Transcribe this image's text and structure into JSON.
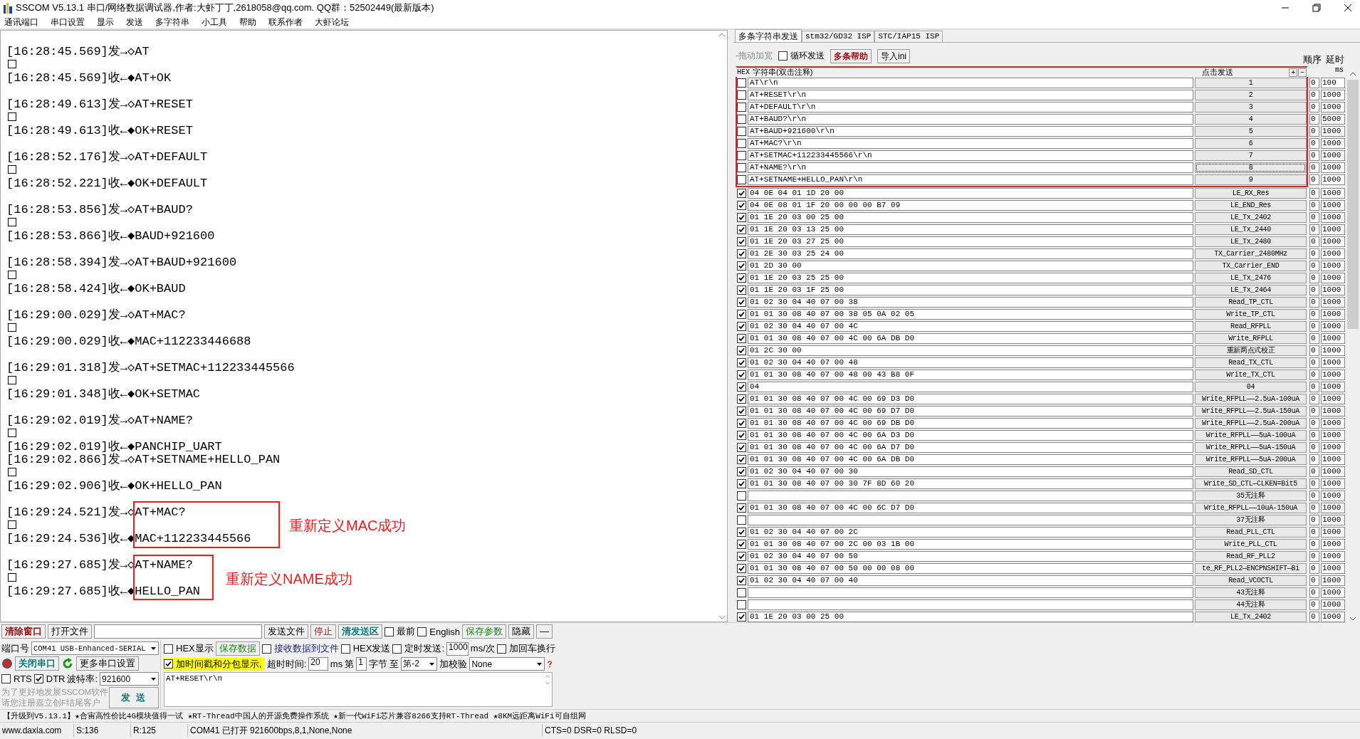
{
  "window": {
    "title": "SSCOM V5.13.1 串口/网络数据调试器,作者:大虾丁丁,2618058@qq.com. QQ群：52502449(最新版本)"
  },
  "menu": [
    "通讯端口",
    "串口设置",
    "显示",
    "发送",
    "多字符串",
    "小工具",
    "帮助",
    "联系作者",
    "大虾论坛"
  ],
  "log": {
    "lines": [
      {
        "kind": "text",
        "text": "[16:28:45.569]发→◇AT"
      },
      {
        "kind": "box"
      },
      {
        "kind": "text",
        "text": "[16:28:45.569]收←◆AT+OK"
      },
      {
        "kind": "blank"
      },
      {
        "kind": "text",
        "text": "[16:28:49.613]发→◇AT+RESET"
      },
      {
        "kind": "box"
      },
      {
        "kind": "text",
        "text": "[16:28:49.613]收←◆OK+RESET"
      },
      {
        "kind": "blank"
      },
      {
        "kind": "text",
        "text": "[16:28:52.176]发→◇AT+DEFAULT"
      },
      {
        "kind": "box"
      },
      {
        "kind": "text",
        "text": "[16:28:52.221]收←◆OK+DEFAULT"
      },
      {
        "kind": "blank"
      },
      {
        "kind": "text",
        "text": "[16:28:53.856]发→◇AT+BAUD?"
      },
      {
        "kind": "box"
      },
      {
        "kind": "text",
        "text": "[16:28:53.866]收←◆BAUD+921600"
      },
      {
        "kind": "blank"
      },
      {
        "kind": "text",
        "text": "[16:28:58.394]发→◇AT+BAUD+921600"
      },
      {
        "kind": "box"
      },
      {
        "kind": "text",
        "text": "[16:28:58.424]收←◆OK+BAUD"
      },
      {
        "kind": "blank"
      },
      {
        "kind": "text",
        "text": "[16:29:00.029]发→◇AT+MAC?"
      },
      {
        "kind": "box"
      },
      {
        "kind": "text",
        "text": "[16:29:00.029]收←◆MAC+112233446688"
      },
      {
        "kind": "blank"
      },
      {
        "kind": "text",
        "text": "[16:29:01.318]发→◇AT+SETMAC+112233445566"
      },
      {
        "kind": "box"
      },
      {
        "kind": "text",
        "text": "[16:29:01.348]收←◆OK+SETMAC"
      },
      {
        "kind": "blank"
      },
      {
        "kind": "text",
        "text": "[16:29:02.019]发→◇AT+NAME?"
      },
      {
        "kind": "box"
      },
      {
        "kind": "text",
        "text": "[16:29:02.019]收←◆PANCHIP_UART"
      },
      {
        "kind": "text",
        "text": "[16:29:02.866]发→◇AT+SETNAME+HELLO_PAN"
      },
      {
        "kind": "box"
      },
      {
        "kind": "text",
        "text": "[16:29:02.906]收←◆OK+HELLO_PAN"
      },
      {
        "kind": "blank"
      },
      {
        "kind": "text",
        "text": "[16:29:24.521]发→◇AT+MAC?"
      },
      {
        "kind": "box"
      },
      {
        "kind": "text",
        "text": "[16:29:24.536]收←◆MAC+112233445566"
      },
      {
        "kind": "blank"
      },
      {
        "kind": "text",
        "text": "[16:29:27.685]发→◇AT+NAME?"
      },
      {
        "kind": "box"
      },
      {
        "kind": "text",
        "text": "[16:29:27.685]收←◆HELLO_PAN"
      }
    ]
  },
  "annotations": [
    {
      "text": "重新定义MAC成功"
    },
    {
      "text": "重新定义NAME成功"
    }
  ],
  "tabs": [
    {
      "label": "多条字符串发送",
      "selected": true
    },
    {
      "label": "stm32/GD32 ISP",
      "selected": false
    },
    {
      "label": "STC/IAP15 ISP",
      "selected": false
    }
  ],
  "multi_send": {
    "drag_label": "-拖动加宽",
    "loop_send": {
      "label": "循环发送",
      "checked": false
    },
    "help_button": "多条帮助",
    "import_button": "导入ini",
    "order_label": "顺序",
    "delay_label": "延时",
    "hex_header": "HEX",
    "string_header": "字符串(双击注释)",
    "send_header": "点击发送",
    "add_button": "+",
    "remove_button": "−",
    "ms_label": "ms",
    "rows": [
      {
        "hex": false,
        "value": "AT\\r\\n",
        "button": "1",
        "order": "0",
        "delay": "100",
        "focused": false,
        "highlighted": true
      },
      {
        "hex": false,
        "value": "AT+RESET\\r\\n",
        "button": "2",
        "order": "0",
        "delay": "1000",
        "focused": false,
        "highlighted": true
      },
      {
        "hex": false,
        "value": "AT+DEFAULT\\r\\n",
        "button": "3",
        "order": "0",
        "delay": "1000",
        "focused": false,
        "highlighted": true
      },
      {
        "hex": false,
        "value": "AT+BAUD?\\r\\n",
        "button": "4",
        "order": "0",
        "delay": "5000",
        "focused": false,
        "highlighted": true
      },
      {
        "hex": false,
        "value": "AT+BAUD+921600\\r\\n",
        "button": "5",
        "order": "0",
        "delay": "1000",
        "focused": false,
        "highlighted": true
      },
      {
        "hex": false,
        "value": "AT+MAC?\\r\\n",
        "button": "6",
        "order": "0",
        "delay": "1000",
        "focused": false,
        "highlighted": true
      },
      {
        "hex": false,
        "value": "AT+SETMAC+112233445566\\r\\n",
        "button": "7",
        "order": "0",
        "delay": "1000",
        "focused": false,
        "highlighted": true
      },
      {
        "hex": false,
        "value": "AT+NAME?\\r\\n",
        "button": "8",
        "order": "0",
        "delay": "1000",
        "focused": true,
        "highlighted": true
      },
      {
        "hex": false,
        "value": "AT+SETNAME+HELLO_PAN\\r\\n",
        "button": "9",
        "order": "0",
        "delay": "1000",
        "focused": false,
        "highlighted": true
      },
      {
        "hex": true,
        "value": "04 0E 04 01 1D 20 00",
        "button": "LE_RX_Res",
        "order": "0",
        "delay": "1000",
        "focused": false,
        "highlighted": false
      },
      {
        "hex": true,
        "value": "04 0E 08 01 1F 20 00 00 00 B7 09",
        "button": "LE_END_Res",
        "order": "0",
        "delay": "1000",
        "focused": false,
        "highlighted": false
      },
      {
        "hex": true,
        "value": "01 1E 20 03 00 25 00",
        "button": "LE_Tx_2402",
        "order": "0",
        "delay": "1000",
        "focused": false,
        "highlighted": false
      },
      {
        "hex": true,
        "value": "01 1E 20 03 13 25 00",
        "button": "LE_Tx_2440",
        "order": "0",
        "delay": "1000",
        "focused": false,
        "highlighted": false
      },
      {
        "hex": true,
        "value": "01 1E 20 03 27 25 00",
        "button": "LE_Tx_2480",
        "order": "0",
        "delay": "1000",
        "focused": false,
        "highlighted": false
      },
      {
        "hex": true,
        "value": "01 2E 30 03 25 24 00",
        "button": "TX_Carrier_2480MHz",
        "order": "0",
        "delay": "1000",
        "focused": false,
        "highlighted": false
      },
      {
        "hex": true,
        "value": "01 2D 30 00",
        "button": "TX_Carrier_END",
        "order": "0",
        "delay": "1000",
        "focused": false,
        "highlighted": false
      },
      {
        "hex": true,
        "value": "01 1E 20 03 25 25 00",
        "button": "LE_Tx_2476",
        "order": "0",
        "delay": "1000",
        "focused": false,
        "highlighted": false
      },
      {
        "hex": true,
        "value": "01 1E 20 03 1F 25 00",
        "button": "LE_Tx_2464",
        "order": "0",
        "delay": "1000",
        "focused": false,
        "highlighted": false
      },
      {
        "hex": true,
        "value": "01 02 30 04 40 07 00 38",
        "button": "Read_TP_CTL",
        "order": "0",
        "delay": "1000",
        "focused": false,
        "highlighted": false
      },
      {
        "hex": true,
        "value": "01 01 30 08 40 07 00 38 05 0A 02 05",
        "button": "Write_TP_CTL",
        "order": "0",
        "delay": "1000",
        "focused": false,
        "highlighted": false
      },
      {
        "hex": true,
        "value": "01 02 30 04 40 07 00 4C",
        "button": "Read_RFPLL",
        "order": "0",
        "delay": "1000",
        "focused": false,
        "highlighted": false
      },
      {
        "hex": true,
        "value": "01 01 30 08 40 07 00 4C 00 6A DB D0",
        "button": "Write_RFPLL",
        "order": "0",
        "delay": "1000",
        "focused": false,
        "highlighted": false
      },
      {
        "hex": true,
        "value": "01 2C 30 00",
        "button": "重新两点式校正",
        "order": "0",
        "delay": "1000",
        "focused": false,
        "highlighted": false
      },
      {
        "hex": true,
        "value": "01 02 30 04 40 07 00 48",
        "button": "Read_TX_CTL",
        "order": "0",
        "delay": "1000",
        "focused": false,
        "highlighted": false
      },
      {
        "hex": true,
        "value": "01 01 30 08 40 07 00 48 00 43 B8 0F",
        "button": "Write_TX_CTL",
        "order": "0",
        "delay": "1000",
        "focused": false,
        "highlighted": false
      },
      {
        "hex": true,
        "value": "04",
        "button": "04",
        "order": "0",
        "delay": "1000",
        "focused": false,
        "highlighted": false
      },
      {
        "hex": true,
        "value": "01 01 30 08 40 07 00 4C 00 69 D3 D0",
        "button": "Write_RFPLL——2.5uA-100uA",
        "order": "0",
        "delay": "1000",
        "focused": false,
        "highlighted": false
      },
      {
        "hex": true,
        "value": "01 01 30 08 40 07 00 4C 00 69 D7 D0",
        "button": "Write_RFPLL——2.5uA-150uA",
        "order": "0",
        "delay": "1000",
        "focused": false,
        "highlighted": false
      },
      {
        "hex": true,
        "value": "01 01 30 08 40 07 00 4C 00 69 DB D0",
        "button": "Write_RFPLL——2.5uA-200uA",
        "order": "0",
        "delay": "1000",
        "focused": false,
        "highlighted": false
      },
      {
        "hex": true,
        "value": "01 01 30 08 40 07 00 4C 00 6A D3 D0",
        "button": "Write_RFPLL——5uA-100uA",
        "order": "0",
        "delay": "1000",
        "focused": false,
        "highlighted": false
      },
      {
        "hex": true,
        "value": "01 01 30 08 40 07 00 4C 00 6A D7 D0",
        "button": "Write_RFPLL——5uA-150uA",
        "order": "0",
        "delay": "1000",
        "focused": false,
        "highlighted": false
      },
      {
        "hex": true,
        "value": "01 01 30 08 40 07 00 4C 00 6A DB D0",
        "button": "Write_RFPLL——5uA-200uA",
        "order": "0",
        "delay": "1000",
        "focused": false,
        "highlighted": false
      },
      {
        "hex": true,
        "value": "01 02 30 04 40 07 00 30",
        "button": "Read_SD_CTL",
        "order": "0",
        "delay": "1000",
        "focused": false,
        "highlighted": false
      },
      {
        "hex": true,
        "value": "01 01 30 08 40 07 00 30 7F 8D 60 20",
        "button": "Write_SD_CTL—CLKEN=Bit5",
        "order": "0",
        "delay": "1000",
        "focused": false,
        "highlighted": false
      },
      {
        "hex": false,
        "button": "35无注释",
        "order": "0",
        "delay": "1000",
        "focused": false,
        "highlighted": false
      },
      {
        "hex": true,
        "value": "01 01 30 08 40 07 00 4C 00 6C D7 D0",
        "button": "Write_RFPLL——10uA-150uA",
        "order": "0",
        "delay": "1000",
        "focused": false,
        "highlighted": false
      },
      {
        "hex": false,
        "button": "37无注释",
        "order": "0",
        "delay": "1000",
        "focused": false,
        "highlighted": false
      },
      {
        "hex": true,
        "value": "01 02 30 04 40 07 00 2C",
        "button": "Read_PLL_CTL",
        "order": "0",
        "delay": "1000",
        "focused": false,
        "highlighted": false
      },
      {
        "hex": true,
        "value": "01 01 30 08 40 07 00 2C 00 03 1B 00",
        "button": "Write_PLL_CTL",
        "order": "0",
        "delay": "1000",
        "focused": false,
        "highlighted": false
      },
      {
        "hex": true,
        "value": "01 02 30 04 40 07 00 50",
        "button": "Read_RF_PLL2",
        "order": "0",
        "delay": "1000",
        "focused": false,
        "highlighted": false
      },
      {
        "hex": true,
        "value": "01 01 30 08 40 07 00 50 00 00 08 00",
        "button": "te_RF_PLL2—ENCPNSHIFT—Bi",
        "order": "0",
        "delay": "1000",
        "focused": false,
        "highlighted": false
      },
      {
        "hex": true,
        "value": "01 02 30 04 40 07 00 40",
        "button": "Read_VCOCTL",
        "order": "0",
        "delay": "1000",
        "focused": false,
        "highlighted": false
      },
      {
        "hex": false,
        "button": "43无注释",
        "order": "0",
        "delay": "1000",
        "focused": false,
        "highlighted": false
      },
      {
        "hex": false,
        "button": "44无注释",
        "order": "0",
        "delay": "1000",
        "focused": false,
        "highlighted": false
      },
      {
        "hex": true,
        "value": "01 1E 20 03 00 25 00",
        "button": "LE_Tx_2402",
        "order": "0",
        "delay": "1000",
        "focused": false,
        "highlighted": false
      }
    ]
  },
  "toolbar": {
    "clear": "清除窗口",
    "open_file": "打开文件",
    "send_file": "发送文件",
    "stop": "停止",
    "clear_send": "清发送区",
    "topmost": {
      "label": "最前",
      "checked": false
    },
    "english": {
      "label": "English",
      "checked": false
    },
    "save_params": "保存参数",
    "hide": "隐藏",
    "collapse": "—"
  },
  "port": {
    "port_label": "端口号",
    "port_value": "COM41 USB-Enhanced-SERIAL",
    "close_port": "关闭串口",
    "more_settings": "更多串口设置",
    "rts": {
      "label": "RTS",
      "checked": false
    },
    "dtr": {
      "label": "DTR",
      "checked": true
    },
    "baud_label": "波特率:",
    "baud_value": "921600",
    "promo": [
      "为了更好地发展SSCOM软件",
      "请您注册嘉立创F结尾客户"
    ],
    "send_button": "发 送"
  },
  "receive": {
    "hex_display": {
      "label": "HEX显示",
      "checked": false
    },
    "save_data": "保存数据",
    "to_file": {
      "label": "接收数据到文件",
      "checked": false
    },
    "timestamp": {
      "label": "加时间戳和分包显示,",
      "checked": true
    },
    "timeout_label": "超时时间:",
    "timeout_value": "20",
    "ms_label": "ms",
    "from_label": "第",
    "from_value": "1",
    "byte_label": "字节",
    "to_label": "至",
    "to_value": "第-2",
    "checksum_label": "加校验",
    "checksum_value": "None"
  },
  "send": {
    "hex_send": {
      "label": "HEX发送",
      "checked": false
    },
    "timed_send": {
      "label": "定时发送:",
      "checked": false
    },
    "interval": "1000",
    "interval_unit": "ms/次",
    "append_crlf": {
      "label": "加回车换行",
      "checked": false
    },
    "text": "AT+RESET\\r\\n"
  },
  "ad": "【升级到V5.13.1】★合宙高性价比4G模块值得一试 ★RT-Thread中国人的开源免费操作系统 ★新一代WiFi芯片兼容8266支持RT-Thread ★8KM远距离WiFi可自组网",
  "status": [
    "www.daxia.com",
    "S:136",
    "R:125",
    "COM41 已打开  921600bps,8,1,None,None",
    "CTS=0 DSR=0 RLSD=0"
  ]
}
